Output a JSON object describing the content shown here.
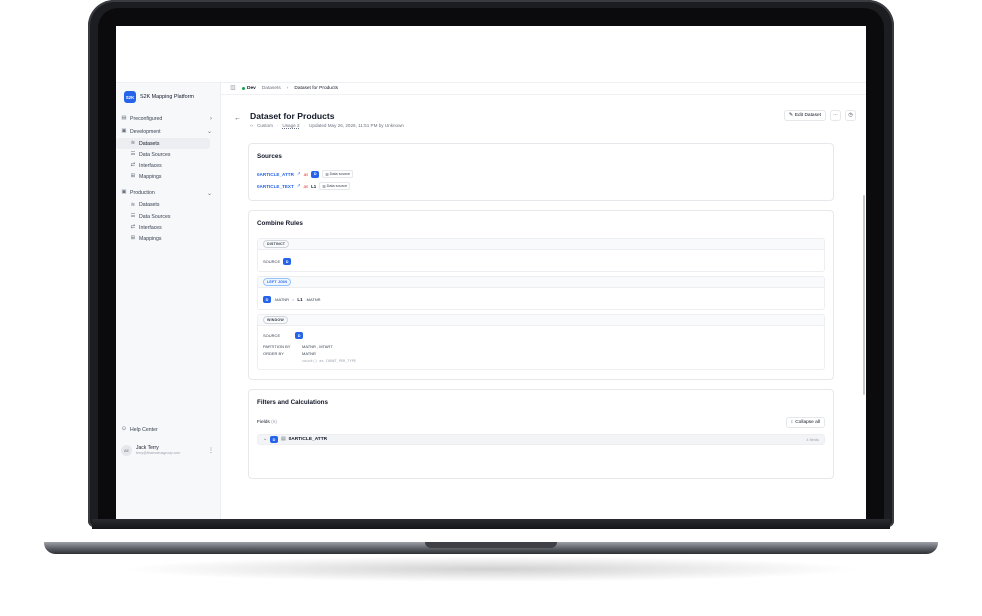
{
  "app": {
    "brand_short": "S2K",
    "brand_name": "S2K Mapping Platform"
  },
  "sidebar": {
    "groups": [
      {
        "label": "Preconfigured",
        "chevron": "›",
        "items": []
      },
      {
        "label": "Development",
        "chevron": "⌄",
        "items": [
          {
            "label": "Datasets",
            "icon": "layers-icon",
            "active": true
          },
          {
            "label": "Data Sources",
            "icon": "database-icon"
          },
          {
            "label": "Interfaces",
            "icon": "interfaces-icon"
          },
          {
            "label": "Mappings",
            "icon": "grid-icon"
          }
        ]
      },
      {
        "label": "Production",
        "chevron": "⌄",
        "items": [
          {
            "label": "Datasets",
            "icon": "layers-icon"
          },
          {
            "label": "Data Sources",
            "icon": "database-icon"
          },
          {
            "label": "Interfaces",
            "icon": "interfaces-icon"
          },
          {
            "label": "Mappings",
            "icon": "grid-icon"
          }
        ]
      }
    ],
    "help": "Help Center",
    "user": {
      "initials": "AE",
      "name": "Jack Terry",
      "email": "terry@finamdeusgroup.com"
    }
  },
  "topbar": {
    "env": "Dev",
    "crumb1": "Datasets",
    "crumb2": "Dataset for Products"
  },
  "header": {
    "title": "Dataset for Products",
    "type": "Custom",
    "usage": "Usage 2",
    "updated": "Updated May 26, 2026, 11:51 PM by Unknown",
    "edit": "Edit Dataset",
    "more": "···"
  },
  "sources": {
    "title": "Sources",
    "rows": [
      {
        "name": "0ARTICLE_ATTR",
        "alias": "as",
        "key": "D",
        "tag": "Data source"
      },
      {
        "name": "0ARTICLE_TEXT",
        "alias": "as",
        "key": "L1",
        "tag": "Data source"
      }
    ]
  },
  "combine": {
    "title": "Combine Rules",
    "distinct": {
      "badge": "DISTINCT",
      "label": "SOURCE",
      "key": "D"
    },
    "join": {
      "badge": "LEFT JOIN",
      "left_key": "D",
      "left_field": ".MATNR",
      "op": "=",
      "right_key": "L1",
      "right_field": ".MATNR"
    },
    "window": {
      "badge": "WINDOW",
      "source_label": "SOURCE",
      "source_key": "D",
      "partition_label": "PARTITION BY",
      "partition_val": "MATNR , MTART",
      "order_label": "ORDER BY",
      "order_val": "MATNR",
      "expr": "count() as COUNT_PER_TYPE"
    }
  },
  "filters": {
    "title": "Filters and Calculations",
    "fields_label": "Fields",
    "fields_count": "(6)",
    "collapse": "Collapse all",
    "group": {
      "key": "D",
      "name": "0ARTICLE_ATTR",
      "count": "4 fields"
    }
  }
}
